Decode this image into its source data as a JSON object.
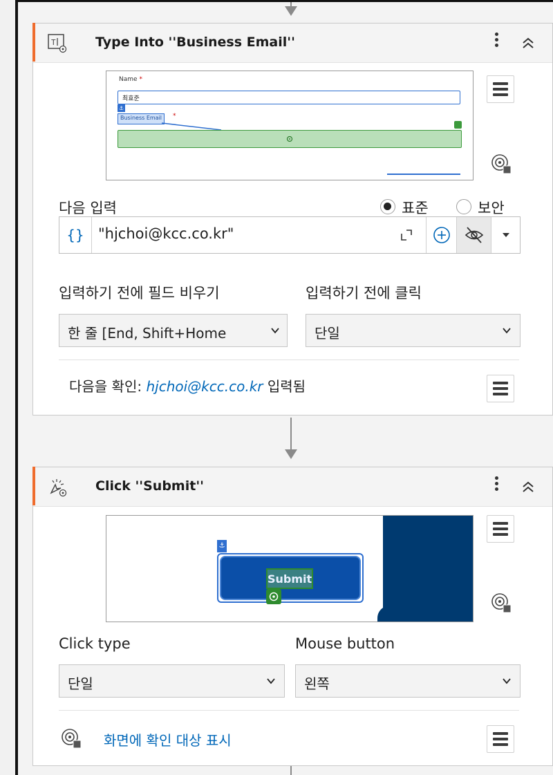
{
  "activity1": {
    "title": "Type Into ''Business Email''",
    "preview": {
      "name_label": "Name",
      "name_value": "최효준",
      "business_email_label": "Business Email",
      "required_mark": "*"
    },
    "input_label": "다음 입력",
    "radio_standard": "표준",
    "radio_secure": "보안",
    "selected_radio": "표준",
    "brace": "{}",
    "input_value": "\"hjchoi@kcc.co.kr\"",
    "empty_field_label": "입력하기 전에 필드 비우기",
    "click_before_label": "입력하기 전에 클릭",
    "empty_field_value": "한 줄 [End, Shift+Home",
    "click_before_value": "단일",
    "verify_prefix": "다음을 확인:",
    "verify_value": "hjchoi@kcc.co.kr",
    "verify_suffix": "입력됨"
  },
  "activity2": {
    "title": "Click ''Submit''",
    "preview": {
      "button_text": "Submit"
    },
    "click_type_label": "Click type",
    "mouse_button_label": "Mouse button",
    "click_type_value": "단일",
    "mouse_button_value": "왼쪽",
    "show_target_link": "화면에 확인 대상 표시"
  },
  "colors": {
    "accent": "#ef6c2d",
    "link": "#0067b8",
    "target_green": "#b9dfb9",
    "submit_blue": "#0b4fa8",
    "navy": "#003a70"
  }
}
